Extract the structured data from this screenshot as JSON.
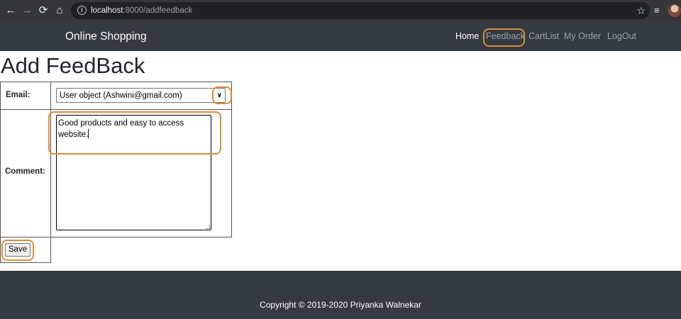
{
  "browser": {
    "url_host": "localhost",
    "url_rest": ":8000/addfeedback",
    "back_icon": "←",
    "forward_icon": "→",
    "reload_icon": "⟳",
    "home_icon": "⌂",
    "bookmark_icon": "☆",
    "queue_icon": "≡"
  },
  "navbar": {
    "brand": "Online Shopping",
    "items": [
      {
        "label": "Home"
      },
      {
        "label": "Feedback"
      },
      {
        "label": "CartList"
      },
      {
        "label": "My Order"
      },
      {
        "label": "LogOut"
      }
    ]
  },
  "form": {
    "title": "Add FeedBack",
    "email_label": "Email:",
    "email_value": "User object (Ashwini@gmail.com)",
    "comment_label": "Comment:",
    "comment_value": "Good products and easy to access\nwebsite.",
    "save_label": "Save"
  },
  "footer": {
    "copyright": "Copyright © 2019-2020 Priyanka Walnekar"
  },
  "colors": {
    "navbar_bg": "#343a40",
    "annotation": "#e08a3c",
    "active_nav": "#ffffff",
    "inactive_nav": "#9aa0a6"
  }
}
